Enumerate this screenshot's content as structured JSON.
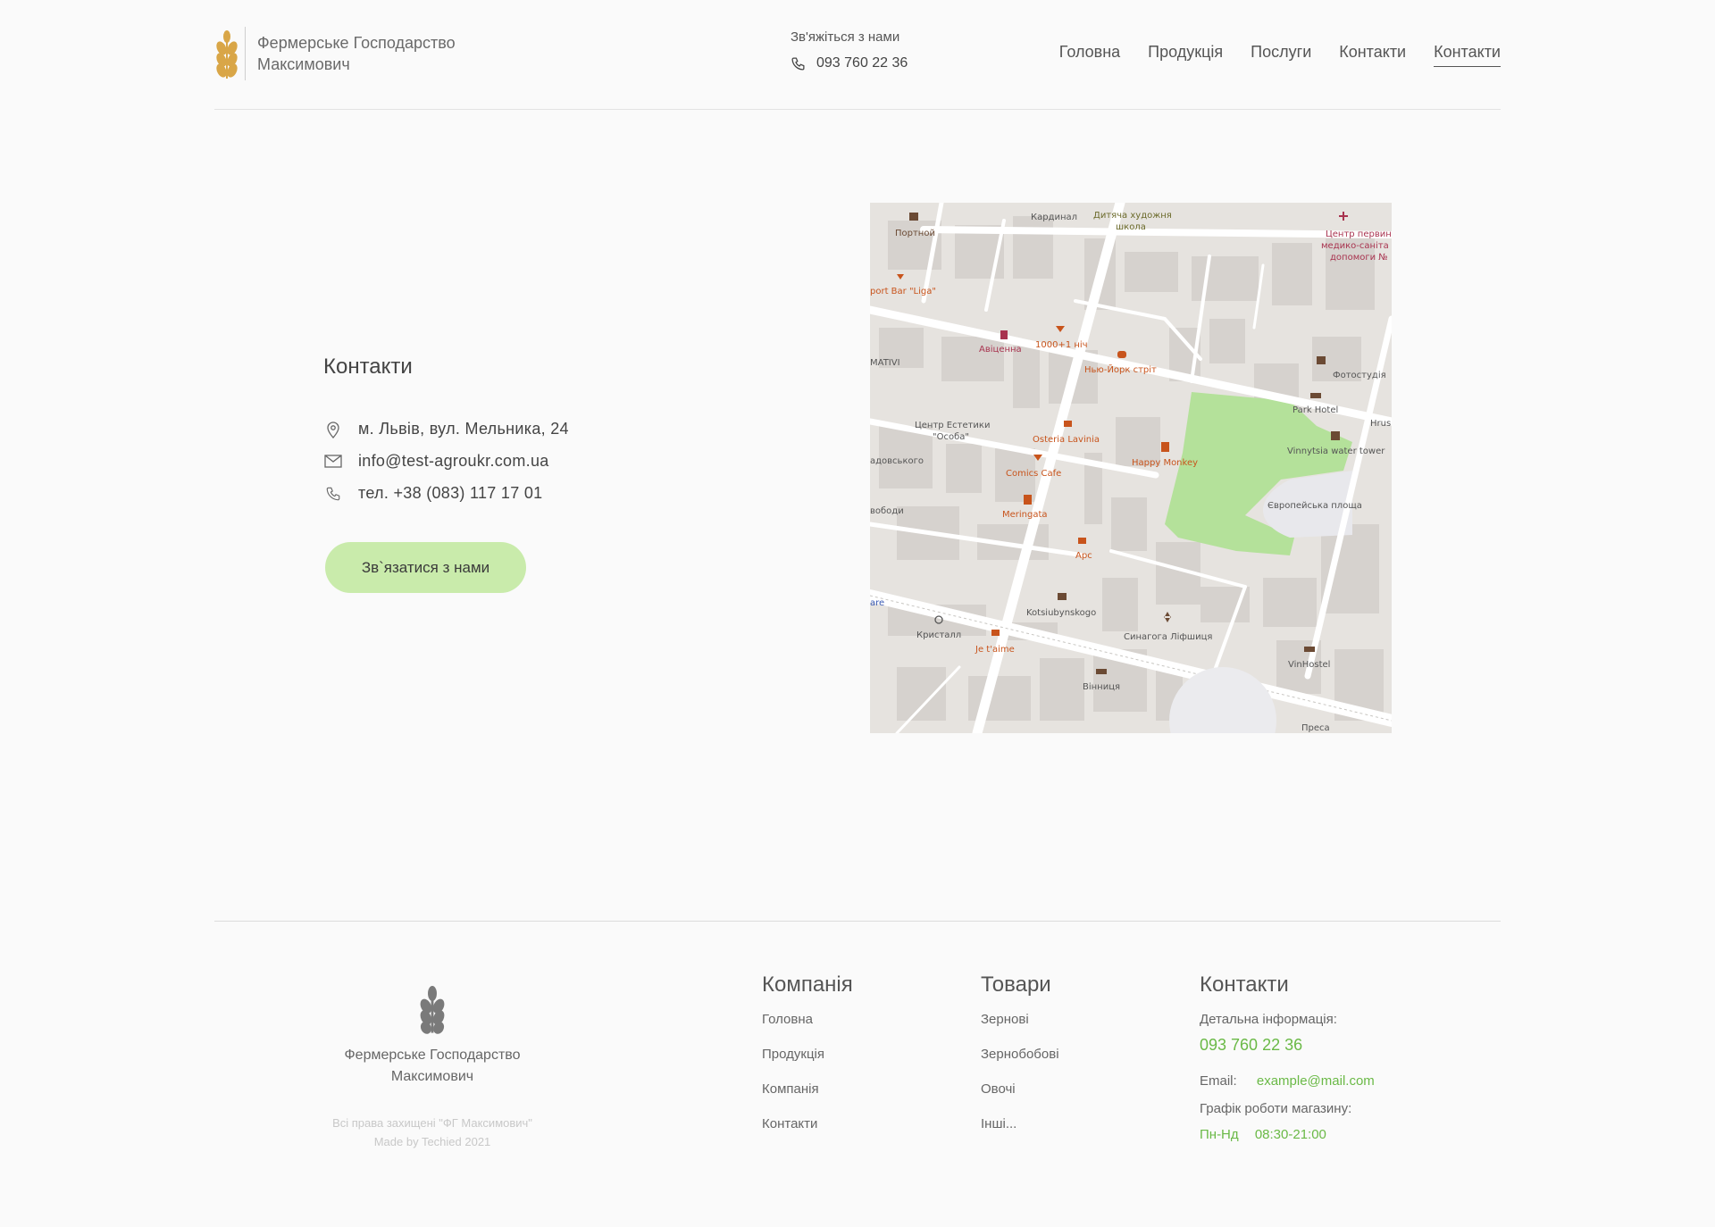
{
  "header": {
    "brand_line1": "Фермерське Господарство",
    "brand_line2": "Максимович",
    "contact_title": "Зв'яжіться з нами",
    "contact_phone": "093 760 22 36",
    "nav": [
      "Головна",
      "Продукція",
      "Послуги",
      "Контакти",
      "Контакти"
    ]
  },
  "contacts": {
    "title": "Контакти",
    "address": "м. Львів, вул. Мельника, 24",
    "email": "info@test-agroukr.com.ua",
    "phone": "тел. +38 (083) 117 17 01",
    "button": "Зв`язатися з нами"
  },
  "map": {
    "labels": {
      "portnoi": "Портной",
      "kardynal": "Кардинал",
      "art_school_1": "Дитяча художня",
      "art_school_2": "школа",
      "medical_1": "Центр первин",
      "medical_2": "медико-саніта",
      "medical_3": "допомоги №",
      "sport_bar": "port Bar \"Liga\"",
      "avicenna": "Авіценна",
      "1001": "1000+1 ніч",
      "newyork": "Нью-Йорк стріт",
      "matyvi": "MATIVI",
      "photostudio": "Фотостудія",
      "park_hotel": "Park Hotel",
      "hrus": "Hrus",
      "aesthetics_1": "Центр Естетики",
      "aesthetics_2": "\"Особа\"",
      "osteria": "Osteria Lavinia",
      "happy_monkey": "Happy Monkey",
      "water_tower": "Vinnytsia water tower",
      "sadovskoho": "адовського",
      "comics": "Comics Cafe",
      "svobody": "вободи",
      "euro_square": "Європейська площа",
      "meringata": "Meringata",
      "arc": "Арс",
      "kotsiubynskogo": "Kotsiubynskogo",
      "are": "are",
      "crystal": "Кристалл",
      "jetaime": "Je t'aime",
      "synagogue": "Синагога Ліфшиця",
      "vinhostel": "VinHostel",
      "vinnytsia": "Вінниця",
      "presa": "Преса"
    },
    "colors": {
      "road": "#ffffff",
      "block": "#d6d2ce",
      "park": "#b4e19a",
      "poi_orange": "#c8541c",
      "poi_brown": "#6b4a34",
      "poi_red": "#a8334f"
    }
  },
  "footer": {
    "brand_line1": "Фермерське Господарство",
    "brand_line2": "Максимович",
    "copyright": "Всі права захищені \"ФГ Максимович\"",
    "made_by": "Made by Techied 2021",
    "company_title": "Компанія",
    "company_links": [
      "Головна",
      "Продукція",
      "Компанія",
      "Контакти"
    ],
    "goods_title": "Товари",
    "goods_links": [
      "Зернові",
      "Зернобобові",
      "Овочі",
      "Інші..."
    ],
    "contacts_title": "Контакти",
    "details_label": "Детальна інформація:",
    "phone": "093 760 22 36",
    "email_label": "Email:",
    "email": "example@mail.com",
    "schedule_label": "Графік роботи магазину:",
    "days": "Пн-Нд",
    "hours": "08:30-21:00"
  },
  "colors": {
    "accent_green": "#6ab946",
    "button_green": "#c9ebab",
    "logo_gold": "#d9a647",
    "logo_gray": "#7a7a7a"
  }
}
